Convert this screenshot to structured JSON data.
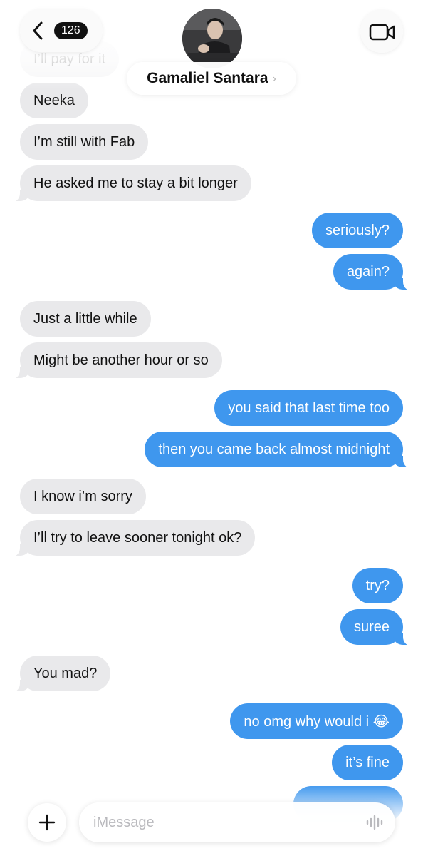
{
  "nav": {
    "unread_count": "126",
    "contact_name": "Gamaliel Santara",
    "contact_chevron": "›"
  },
  "messages": [
    {
      "dir": "in",
      "text": "Neeka"
    },
    {
      "dir": "in",
      "text": "I’m still with Fab"
    },
    {
      "dir": "in",
      "text": "He asked me to stay a bit longer"
    },
    {
      "dir": "out",
      "text": "seriously?"
    },
    {
      "dir": "out",
      "text": "again?"
    },
    {
      "dir": "in",
      "text": "Just a little while"
    },
    {
      "dir": "in",
      "text": "Might be another hour or so"
    },
    {
      "dir": "out",
      "text": "you said that last time too"
    },
    {
      "dir": "out",
      "text": "then you came back almost midnight"
    },
    {
      "dir": "in",
      "text": "I know i’m sorry"
    },
    {
      "dir": "in",
      "text": "I’ll try to leave sooner tonight ok?"
    },
    {
      "dir": "out",
      "text": "try?"
    },
    {
      "dir": "out",
      "text": "suree"
    },
    {
      "dir": "in",
      "text": "You mad?"
    },
    {
      "dir": "out",
      "text": "no omg why would i 😂"
    },
    {
      "dir": "out",
      "text": "it’s fine"
    }
  ],
  "faded_messages": [
    {
      "dir": "in",
      "text": "I’ll pay for it"
    }
  ],
  "compose": {
    "placeholder": "iMessage"
  },
  "icons": {
    "back": "chevron-left-icon",
    "video": "video-camera-icon",
    "add": "plus-icon",
    "mic": "audio-waveform-icon"
  },
  "colors": {
    "outgoing_bubble": "#3f97ee",
    "incoming_bubble": "#e9e9eb",
    "background": "#ffffff"
  }
}
